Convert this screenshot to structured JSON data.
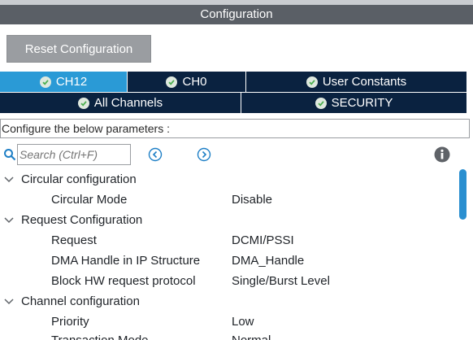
{
  "window": {
    "title": "Configuration"
  },
  "toolbar": {
    "reset_label": "Reset Configuration"
  },
  "tabs": [
    {
      "label": "CH12",
      "active": true
    },
    {
      "label": "CH0",
      "active": false
    },
    {
      "label": "User Constants",
      "active": false
    },
    {
      "label": "All Channels",
      "active": false
    },
    {
      "label": "SECURITY",
      "active": false
    }
  ],
  "params_header": "Configure the below parameters :",
  "search": {
    "placeholder": "Search (Ctrl+F)"
  },
  "tree": [
    {
      "type": "group",
      "label": "Circular configuration"
    },
    {
      "type": "param",
      "label": "Circular Mode",
      "value": "Disable"
    },
    {
      "type": "group",
      "label": "Request Configuration"
    },
    {
      "type": "param",
      "label": "Request",
      "value": "DCMI/PSSI"
    },
    {
      "type": "param",
      "label": "DMA Handle in IP Structure",
      "value": "DMA_Handle"
    },
    {
      "type": "param",
      "label": "Block HW request protocol",
      "value": "Single/Burst Level"
    },
    {
      "type": "group",
      "label": "Channel configuration"
    },
    {
      "type": "param",
      "label": "Priority",
      "value": "Low"
    },
    {
      "type": "param",
      "label": "Transaction Mode",
      "value": "Normal"
    }
  ],
  "colors": {
    "active_tab": "#2a9ad6",
    "inactive_tab": "#0a2240",
    "check_icon": "#4caf50",
    "scrollbar": "#2a8fd0"
  },
  "icons": {
    "search": "search-icon",
    "prev": "previous-arrow-icon",
    "next": "next-arrow-icon",
    "info": "info-icon",
    "expand": "chevron-down-icon",
    "tab_status": "checkmark-icon"
  }
}
